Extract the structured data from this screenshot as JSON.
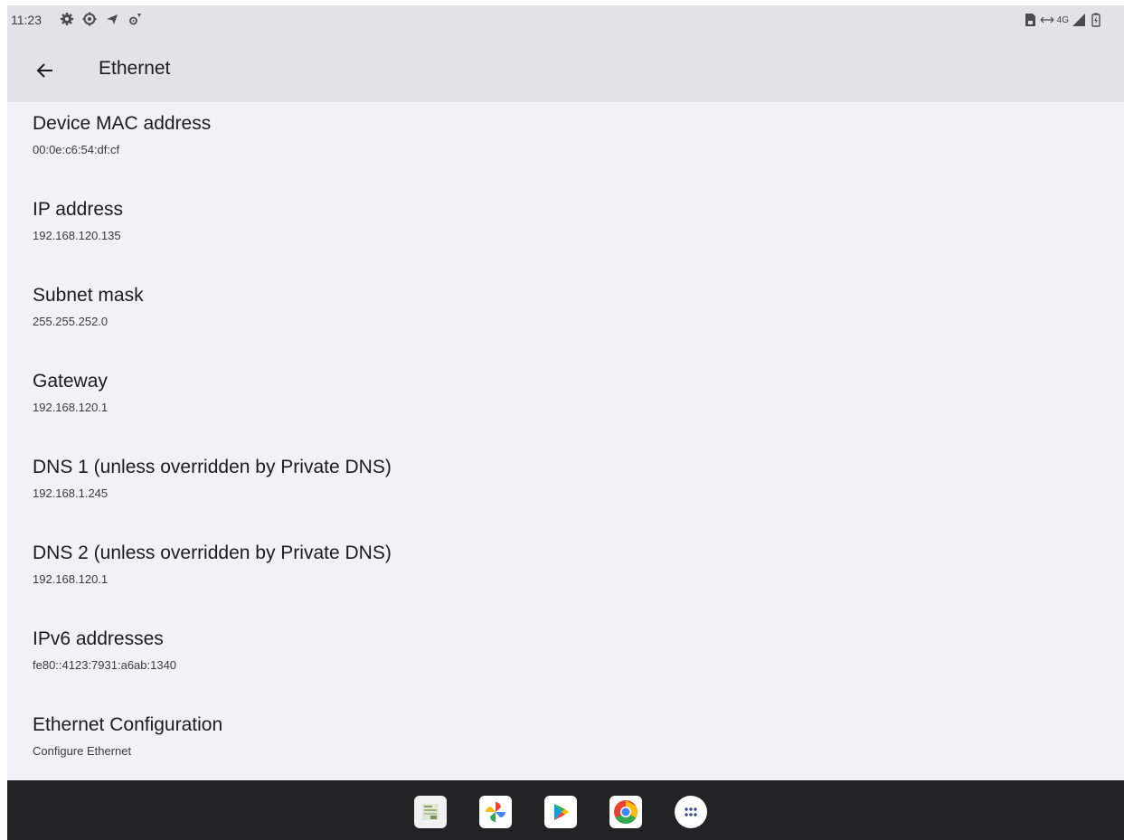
{
  "status_bar": {
    "time": "11:23",
    "left_icons": [
      "settings-gear-icon",
      "settings-cog-icon",
      "location-arrow-icon",
      "device-settings-icon"
    ],
    "network_label": "4G"
  },
  "app_bar": {
    "title": "Ethernet",
    "back_icon": "arrow-back-icon"
  },
  "items": [
    {
      "title": "Device MAC address",
      "summary": "00:0e:c6:54:df:cf"
    },
    {
      "title": "IP address",
      "summary": "192.168.120.135"
    },
    {
      "title": "Subnet mask",
      "summary": "255.255.252.0"
    },
    {
      "title": "Gateway",
      "summary": "192.168.120.1"
    },
    {
      "title": "DNS 1 (unless overridden by Private DNS)",
      "summary": "192.168.1.245"
    },
    {
      "title": "DNS 2 (unless overridden by Private DNS)",
      "summary": "192.168.120.1"
    },
    {
      "title": "IPv6 addresses",
      "summary": "fe80::4123:7931:a6ab:1340"
    },
    {
      "title": "Ethernet Configuration",
      "summary": "Configure Ethernet"
    }
  ],
  "dock": {
    "apps": [
      "files-app-icon",
      "photos-app-icon",
      "play-store-icon",
      "chrome-icon",
      "app-drawer-icon"
    ]
  },
  "colors": {
    "bar_background": "#e3e2e7",
    "page_background": "#f2f1f6",
    "dock_background": "#232325"
  }
}
